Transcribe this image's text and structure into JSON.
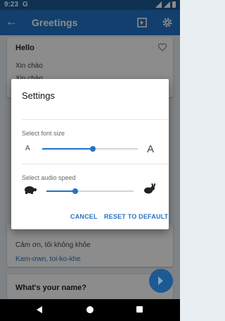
{
  "status_bar": {
    "time": "9:23",
    "app_letter": "G"
  },
  "app_bar": {
    "back_icon": "arrow-back-icon",
    "title": "Greetings"
  },
  "background_cards": [
    {
      "title": "Hello",
      "text": "Xin chào",
      "partial_text": "Xin chào"
    },
    {
      "text": "Cảm ơn, tôi không khỏe",
      "pronunciation": "Kam-ơwn, toi-ko-khe"
    },
    {
      "title": "What's your name?"
    }
  ],
  "dialog": {
    "title": "Settings",
    "font_size": {
      "label": "Select font size",
      "small_glyph": "A",
      "large_glyph": "A",
      "value_fraction": 0.53
    },
    "audio_speed": {
      "label": "Select audio speed",
      "slow_icon": "turtle-icon",
      "fast_icon": "rabbit-icon",
      "value_fraction": 0.33
    },
    "cancel_label": "CANCEL",
    "reset_label": "RESET TO DEFAULT"
  },
  "colors": {
    "primary": "#2174c6",
    "primary_dark": "#1d5a94",
    "accent_text": "#2a73c0"
  }
}
